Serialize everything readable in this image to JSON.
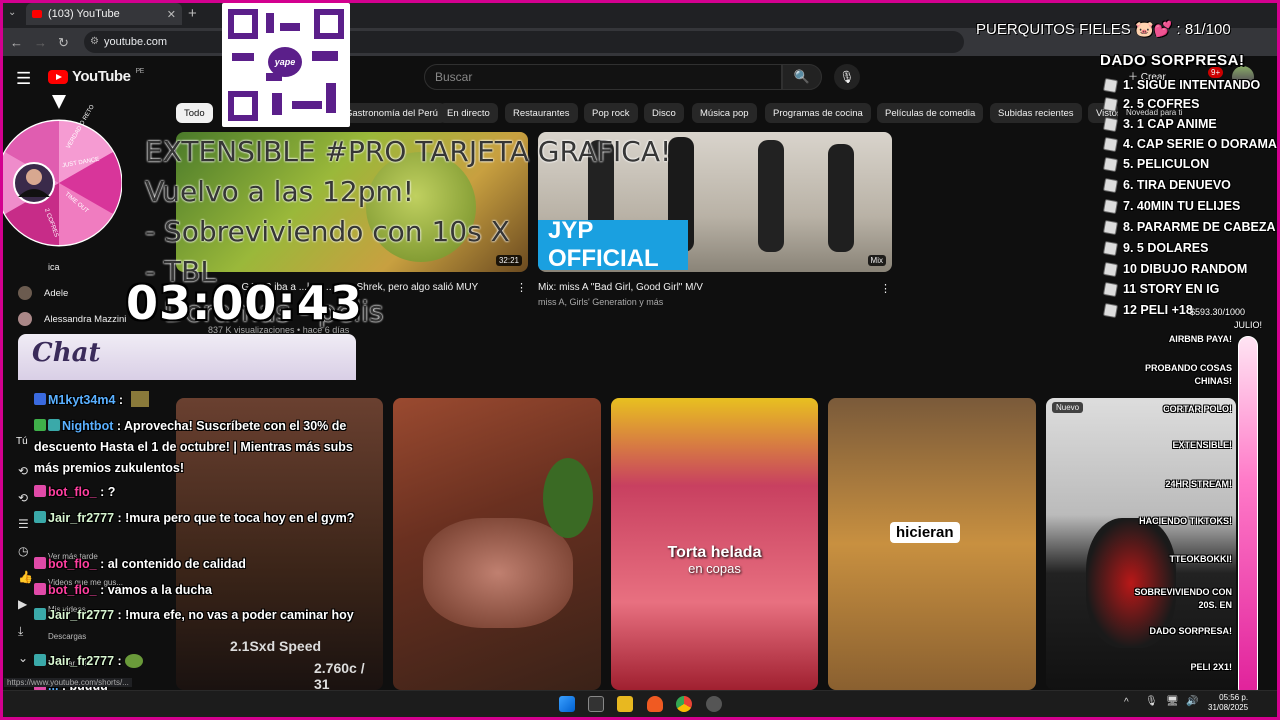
{
  "browser": {
    "tab_title": "(103) YouTube",
    "url": "youtube.com",
    "status_url": "https://www.youtube.com/shorts/..."
  },
  "youtube": {
    "logo_text": "YouTube",
    "country": "PE",
    "search_placeholder": "Buscar",
    "create_label": "Crear",
    "notifications": "9+"
  },
  "chips": [
    "Todo",
    "Gastronomía del Perú",
    "En directo",
    "Restaurantes",
    "Pop rock",
    "Disco",
    "Música pop",
    "Programas de cocina",
    "Películas de comedia",
    "Subidas recientes",
    "Vistos",
    "Novedad para ti"
  ],
  "sidebar": {
    "channels": [
      "Adele",
      "Alessandra Mazzini"
    ],
    "partial": "ica",
    "you_label": "Tú",
    "you_items": [
      "Ver más tarde",
      "Videos que me gus...",
      "Mis videos",
      "Descargas",
      "Mostrar más"
    ]
  },
  "videos": [
    {
      "title_visible": "M... GA...R iba a ...la... ...ente Shrek, pero algo salió MUY",
      "duration": "32:21",
      "meta": "837 K visualizaciones • hace 6 días"
    },
    {
      "title": "Mix: miss A \"Bad Girl, Good Girl\" M/V",
      "meta": "miss A, Girls' Generation y más",
      "thumb_text": "JYP OFFICIAL",
      "badge": "Mix"
    }
  ],
  "shorts": [
    {
      "overlay": "2.1Sxd Speed",
      "overlay2": "2.760c / 31"
    },
    {},
    {
      "overlay": "Torta helada",
      "overlay2": "en copas"
    },
    {
      "overlay": "hicieran"
    },
    {
      "badge": "Nuevo"
    }
  ],
  "overlay": {
    "qr_label": "yape",
    "notes": [
      "EXTENSIBLE #PRO TARJETA GRAFICA!",
      "Vuelvo a las 12pm!",
      "- Sobreviviendo con 10s X",
      "- TBL",
      "- Doramas - pelis"
    ],
    "timer": "03:00:43",
    "wheel_segments": [
      "JUST DANCE",
      "TIME OUT",
      "2 COFRES",
      "VERDAD O RETO"
    ],
    "goal_label": "PUERQUITOS FIELES",
    "goal_count": "81/100",
    "dado_title": "DADO SORPRESA!",
    "prizes": [
      "1. SIGUE INTENTANDO",
      "2. 5 COFRES",
      "3. 1 CAP ANIME",
      "4. CAP SERIE O DORAMA",
      "5. PELICULON",
      "6. TIRA DENUEVO",
      "7. 40MIN TU ELIJES",
      "8. PARARME DE CABEZA",
      "9. 5 DOLARES",
      "10 DIBUJO RANDOM",
      "11 STORY EN IG",
      "12 PELI +18"
    ],
    "money": "$593.30/1000",
    "month": "JULIO!",
    "goals": [
      "AIRBNB PAYA!",
      "PROBANDO COSAS CHINAS!",
      "CORTAR POLO!",
      "EXTENSIBLE!",
      "24HR STREAM!",
      "HACIENDO TIKTOKS!",
      "TTEOKBOKKI!",
      "SOBREVIVIENDO CON 20S. EN",
      "DADO SORPRESA!",
      "PELI 2X1!"
    ]
  },
  "chat": {
    "title": "Chat",
    "messages": [
      {
        "user": "M1kyt34m4",
        "text": ""
      },
      {
        "user": "Nightbot",
        "text": "Aprovecha! Suscríbete con el 30% de descuento Hasta el 1 de octubre! | Mientras más subs más premios zukulentos!"
      },
      {
        "user": "bot_flo_",
        "text": "?"
      },
      {
        "user": "Jair_fr2777",
        "text": "!mura pero que te toca hoy en el gym?"
      },
      {
        "user": "bot_flo_",
        "text": "al contenido de calidad"
      },
      {
        "user": "bot_flo_",
        "text": "vamos a la ducha"
      },
      {
        "user": "Jair_fr2777",
        "text": "!mura efe, no vas a poder caminar hoy"
      },
      {
        "user": "Jair_fr2777",
        "text": ""
      },
      {
        "user": "...",
        "text": "buuuu"
      }
    ]
  },
  "taskbar": {
    "time": "05:56 p.",
    "date": "31/08/2025"
  }
}
